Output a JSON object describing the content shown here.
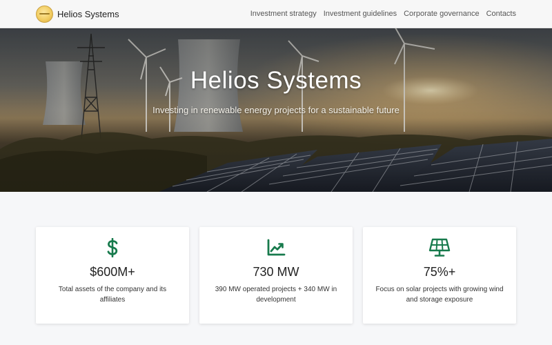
{
  "header": {
    "brand_name": "Helios Systems",
    "nav": [
      {
        "label": "Investment strategy"
      },
      {
        "label": "Investment guidelines"
      },
      {
        "label": "Corporate governance"
      },
      {
        "label": "Contacts"
      }
    ]
  },
  "hero": {
    "title": "Helios Systems",
    "subtitle": "Investing in renewable energy projects for a sustainable future"
  },
  "stats": [
    {
      "icon": "dollar-icon",
      "value": "$600M+",
      "description": "Total assets of the company and its affiliates"
    },
    {
      "icon": "chart-line-icon",
      "value": "730 MW",
      "description": "390 MW operated projects + 340 MW in development"
    },
    {
      "icon": "solar-panel-icon",
      "value": "75%+",
      "description": "Focus on solar projects with growing wind and storage exposure"
    }
  ],
  "colors": {
    "accent": "#177a4c",
    "page_background": "#f6f7f9",
    "header_background": "#f7f7f7"
  }
}
